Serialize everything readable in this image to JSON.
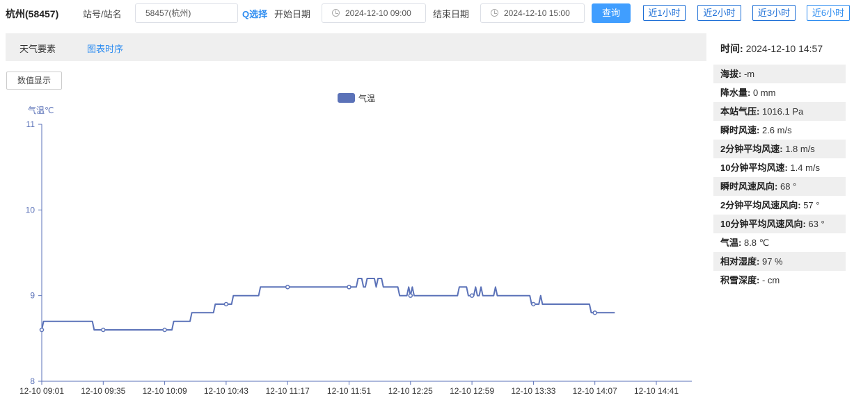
{
  "header": {
    "station_title": "杭州(58457)",
    "station_label": "站号/站名",
    "station_value": "58457(杭州)",
    "select_label": "Q选择",
    "start_label": "开始日期",
    "start_value": "2024-12-10 09:00",
    "end_label": "结束日期",
    "end_value": "2024-12-10 15:00",
    "query_label": "查询",
    "quick_buttons": [
      "近1小时",
      "近2小时",
      "近3小时",
      "近6小时"
    ]
  },
  "tabs": {
    "weather": "天气要素",
    "chart": "图表时序"
  },
  "num_display_label": "数值显示",
  "colors": {
    "accent": "#409eff",
    "series": "#5b72b8",
    "link": "#2d8cf0"
  },
  "chart_data": {
    "type": "line",
    "legend": [
      "气温"
    ],
    "ylabel": "气温℃",
    "ylim": [
      8,
      11
    ],
    "yticks": [
      8,
      9,
      10,
      11
    ],
    "xticks": [
      "12-10 09:01",
      "12-10 09:35",
      "12-10 10:09",
      "12-10 10:43",
      "12-10 11:17",
      "12-10 11:51",
      "12-10 12:25",
      "12-10 12:59",
      "12-10 13:33",
      "12-10 14:07",
      "12-10 14:41"
    ],
    "series": [
      {
        "name": "气温",
        "points": [
          [
            0,
            8.6
          ],
          [
            1,
            8.7
          ],
          [
            28,
            8.7
          ],
          [
            29,
            8.6
          ],
          [
            72,
            8.6
          ],
          [
            73,
            8.7
          ],
          [
            82,
            8.7
          ],
          [
            83,
            8.8
          ],
          [
            95,
            8.8
          ],
          [
            96,
            8.9
          ],
          [
            105,
            8.9
          ],
          [
            106,
            9.0
          ],
          [
            120,
            9.0
          ],
          [
            121,
            9.1
          ],
          [
            174,
            9.1
          ],
          [
            175,
            9.2
          ],
          [
            177,
            9.2
          ],
          [
            178,
            9.1
          ],
          [
            179,
            9.1
          ],
          [
            180,
            9.2
          ],
          [
            184,
            9.2
          ],
          [
            185,
            9.1
          ],
          [
            186,
            9.2
          ],
          [
            188,
            9.2
          ],
          [
            189,
            9.1
          ],
          [
            197,
            9.1
          ],
          [
            198,
            9.0
          ],
          [
            202,
            9.0
          ],
          [
            203,
            9.1
          ],
          [
            204,
            9.0
          ],
          [
            205,
            9.1
          ],
          [
            206,
            9.0
          ],
          [
            230,
            9.0
          ],
          [
            231,
            9.1
          ],
          [
            235,
            9.1
          ],
          [
            236,
            9.0
          ],
          [
            239,
            9.0
          ],
          [
            240,
            9.1
          ],
          [
            241,
            9.0
          ],
          [
            242,
            9.0
          ],
          [
            243,
            9.1
          ],
          [
            244,
            9.0
          ],
          [
            250,
            9.0
          ],
          [
            251,
            9.1
          ],
          [
            252,
            9.0
          ],
          [
            270,
            9.0
          ],
          [
            271,
            8.9
          ],
          [
            275,
            8.9
          ],
          [
            276,
            9.0
          ],
          [
            277,
            8.9
          ],
          [
            303,
            8.9
          ],
          [
            304,
            8.8
          ],
          [
            317,
            8.8
          ]
        ],
        "markers": [
          0,
          34,
          68,
          102,
          136,
          170,
          204,
          238,
          272,
          306
        ]
      }
    ]
  },
  "panel": {
    "time_label": "时间:",
    "time_value": "2024-12-10 14:57",
    "rows": [
      {
        "k": "海拔:",
        "v": "-m"
      },
      {
        "k": "降水量:",
        "v": "0   mm"
      },
      {
        "k": "本站气压:",
        "v": "1016.1   Pa"
      },
      {
        "k": "瞬时风速:",
        "v": "2.6   m/s"
      },
      {
        "k": "2分钟平均风速:",
        "v": "1.8   m/s"
      },
      {
        "k": "10分钟平均风速:",
        "v": "1.4   m/s"
      },
      {
        "k": "瞬时风速风向:",
        "v": "68   °"
      },
      {
        "k": "2分钟平均风速风向:",
        "v": "57   °"
      },
      {
        "k": "10分钟平均风速风向:",
        "v": "63   °"
      },
      {
        "k": "气温:",
        "v": "8.8   ℃"
      },
      {
        "k": "相对湿度:",
        "v": "97   %"
      },
      {
        "k": "积雪深度:",
        "v": "-   cm"
      }
    ]
  }
}
